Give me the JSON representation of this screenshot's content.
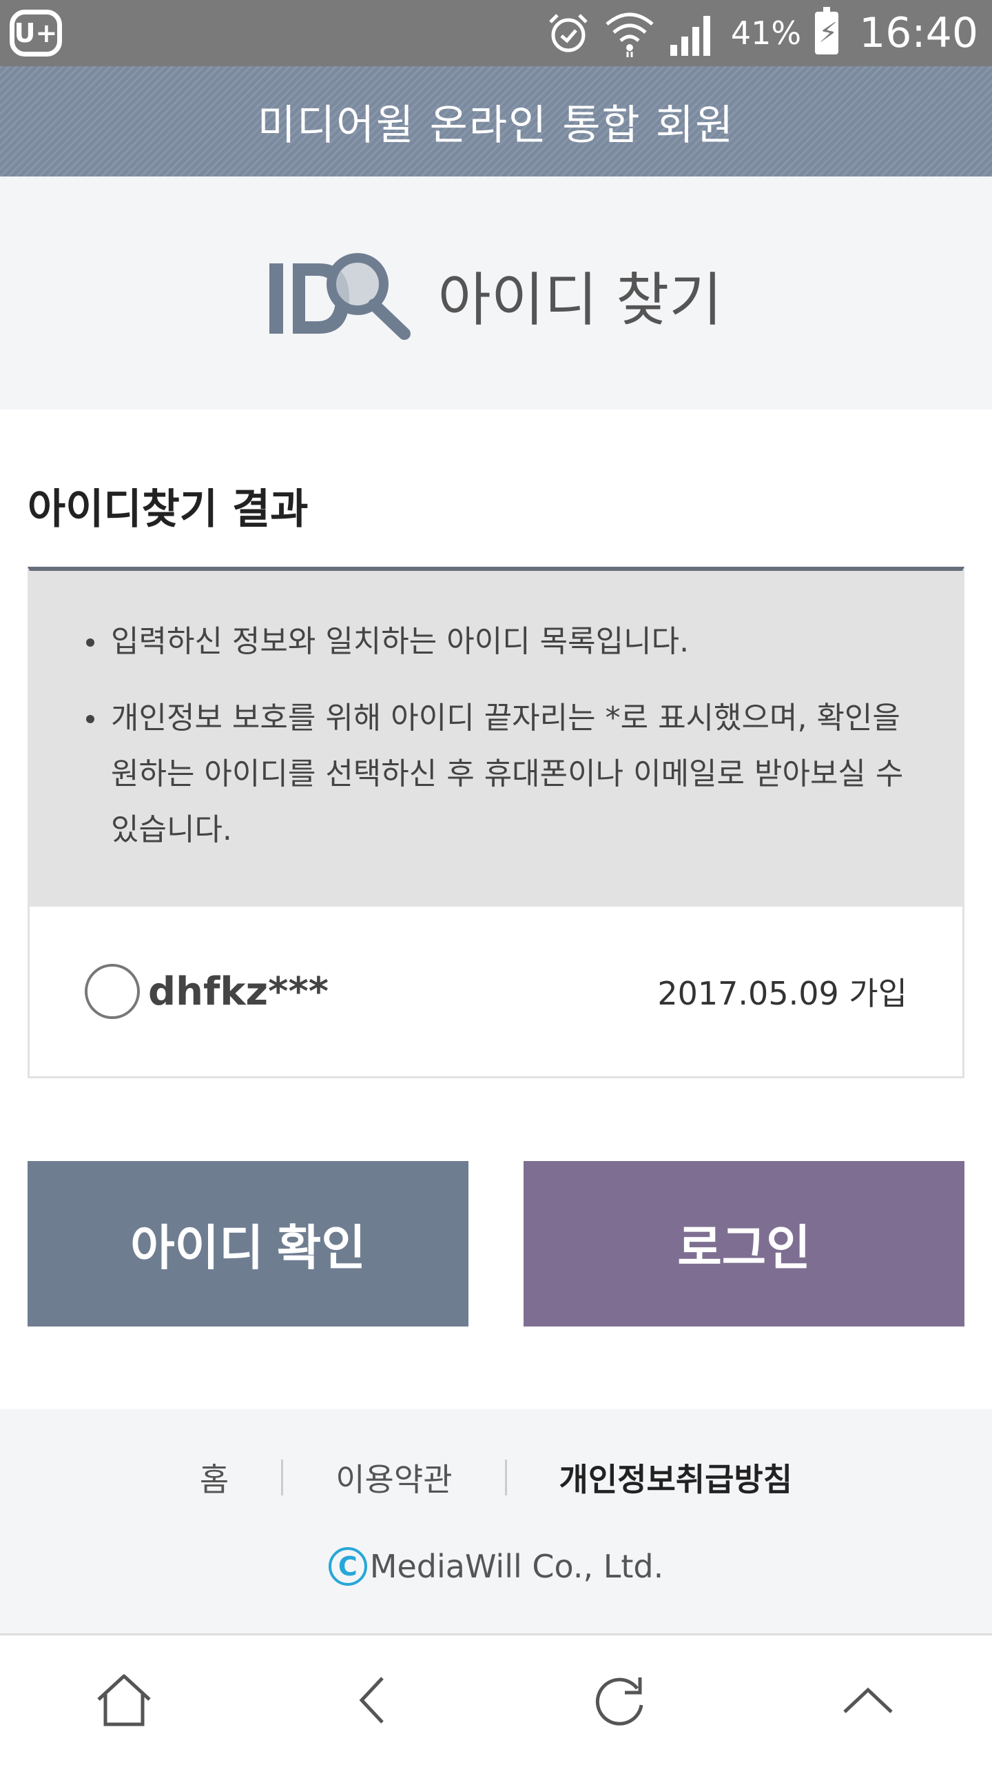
{
  "status_bar": {
    "carrier": "U+",
    "battery_percent": "41%",
    "time": "16:40",
    "icons": [
      "alarm-icon",
      "wifi-icon",
      "signal-icon",
      "battery-charging-icon"
    ]
  },
  "header": {
    "title": "미디어윌 온라인 통합 회원"
  },
  "hero": {
    "logo_text": "ID",
    "title": "아이디 찾기"
  },
  "result": {
    "title": "아이디찾기 결과",
    "notices": [
      "입력하신 정보와 일치하는 아이디 목록입니다.",
      "개인정보 보호를 위해 아이디 끝자리는 *로 표시했으며, 확인을 원하는 아이디를 선택하신 후 휴대폰이나 이메일로 받아보실 수 있습니다."
    ],
    "items": [
      {
        "id": "dhfkz***",
        "joined": "2017.05.09 가입",
        "selected": false
      }
    ]
  },
  "buttons": {
    "confirm_label": "아이디 확인",
    "login_label": "로그인",
    "confirm_color": "#6f7d91",
    "login_color": "#7e6f92"
  },
  "footer": {
    "links": [
      "홈",
      "이용약관",
      "개인정보취급방침"
    ],
    "copyright_symbol": "C",
    "copyright": "MediaWill Co., Ltd."
  },
  "bottom_nav": {
    "icons": [
      "home-icon",
      "back-icon",
      "refresh-icon",
      "scroll-top-icon"
    ]
  }
}
